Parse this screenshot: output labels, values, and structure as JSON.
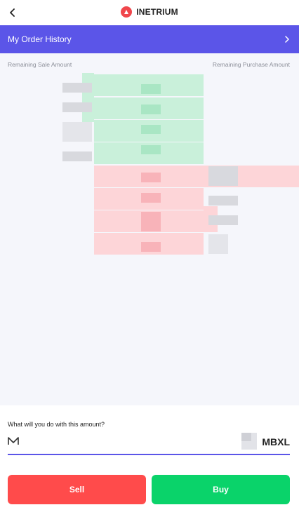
{
  "header": {
    "back_icon": "chevron-left-icon",
    "brand_icon": "brand-logo-icon",
    "brand_name": "INETRIUM"
  },
  "history": {
    "label": "My Order History",
    "icon": "chevron-right-icon"
  },
  "orderbook": {
    "left_header": "Remaining Sale Amount",
    "right_header": "Remaining Purchase Amount"
  },
  "trade": {
    "question": "What will you do with this amount?",
    "token_icon": "mbxl-token-icon",
    "amount_value": "",
    "unit": "MBXL"
  },
  "actions": {
    "sell_label": "Sell",
    "buy_label": "Buy"
  },
  "colors": {
    "accent": "#5b55e8",
    "sell": "#ff4b4b",
    "buy": "#0ad36a",
    "ask_bg": "#c9f0da",
    "bid_bg": "#fdd5d8"
  }
}
